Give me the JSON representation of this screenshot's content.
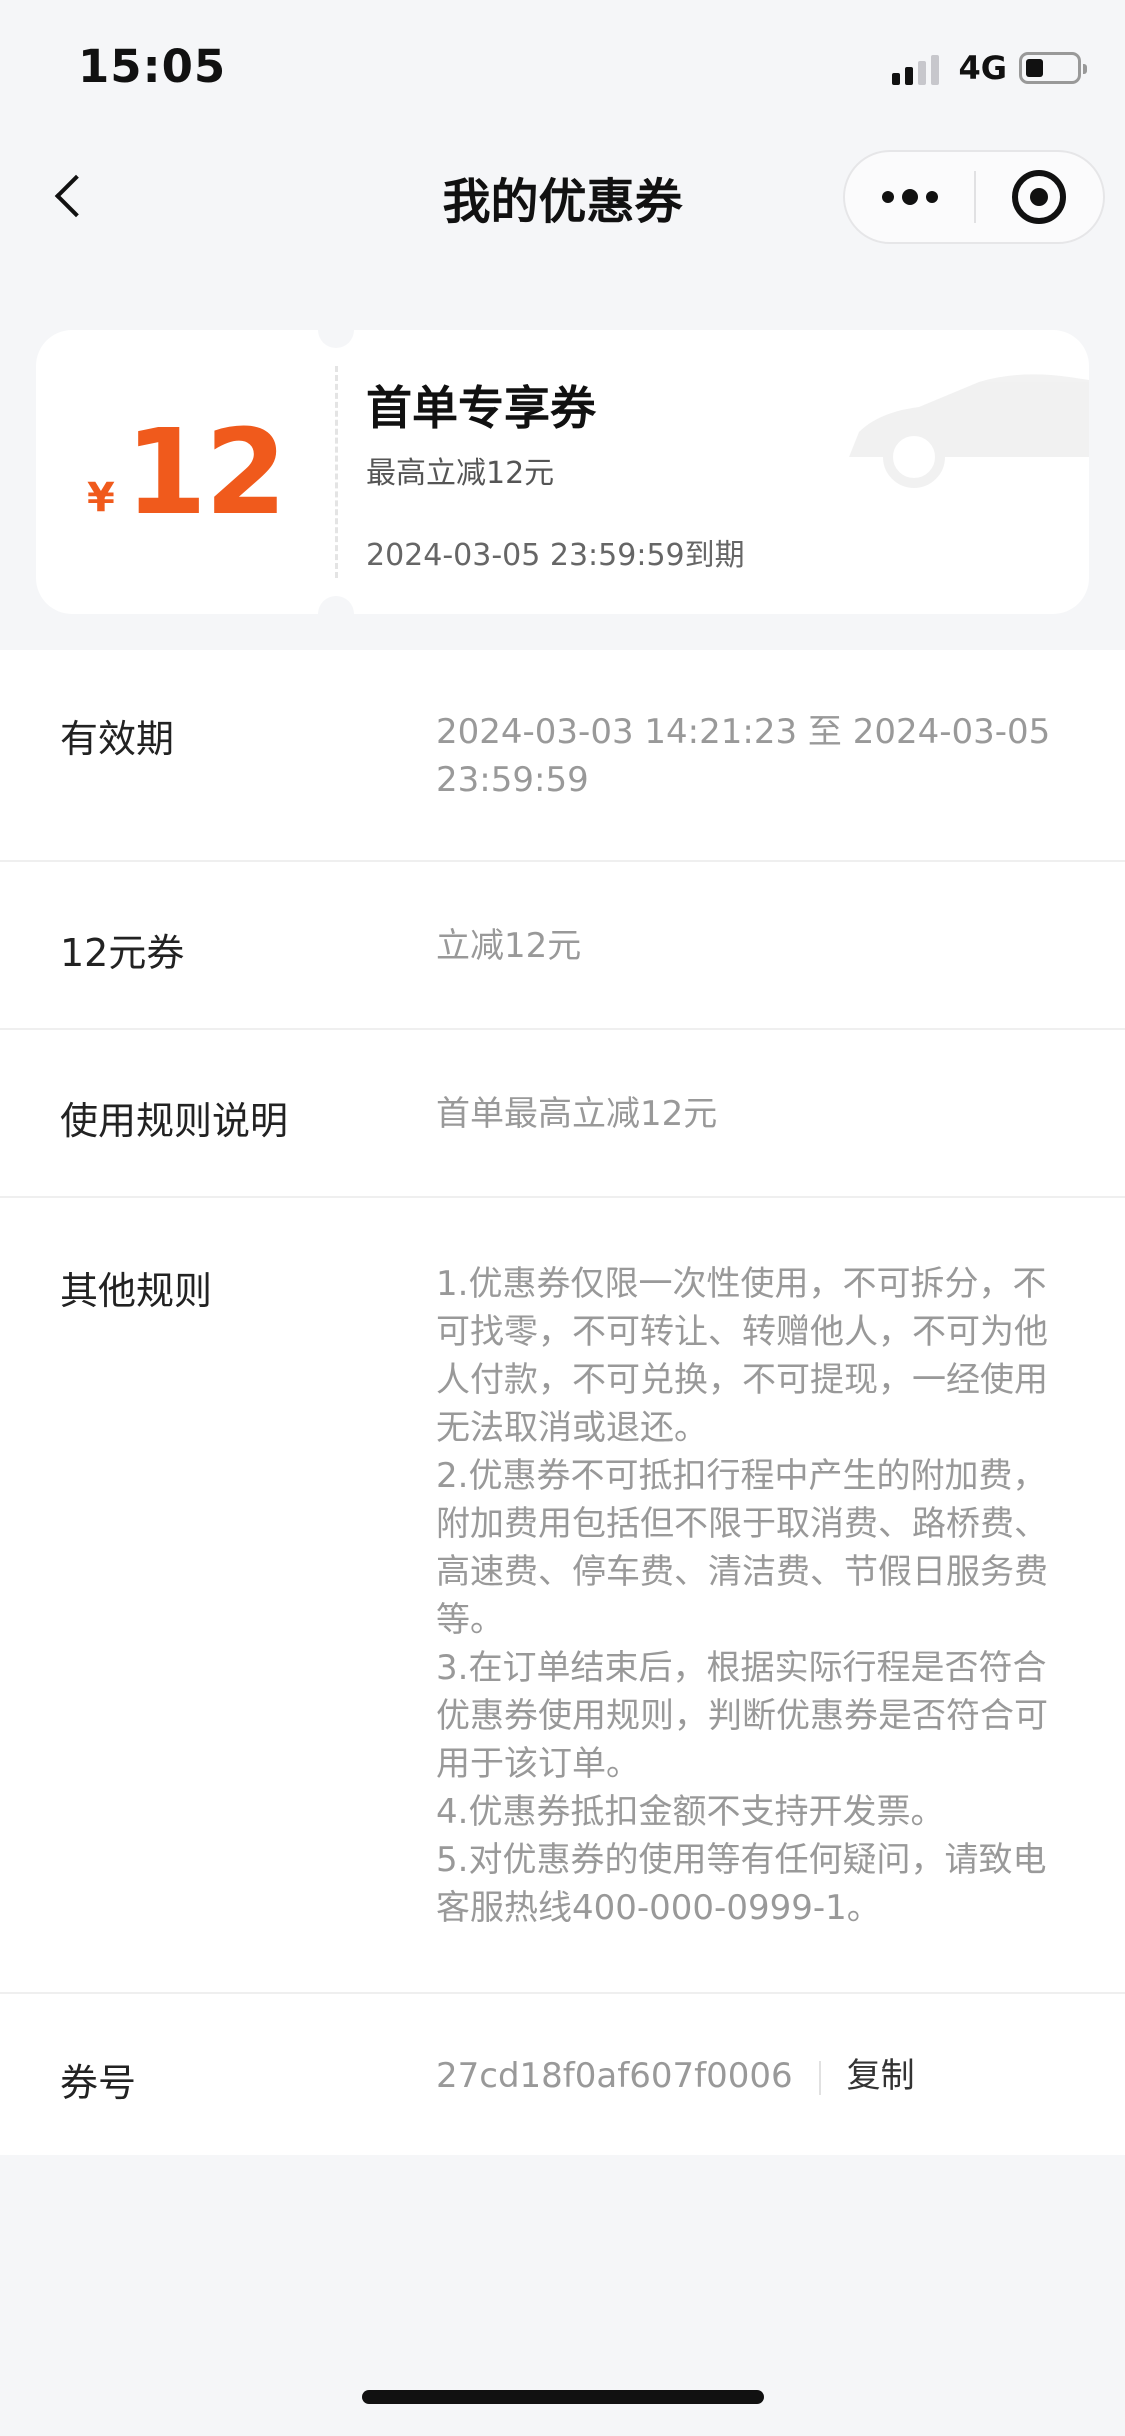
{
  "status_bar": {
    "time": "15:05",
    "network": "4G",
    "battery_level": 0.35
  },
  "nav": {
    "title": "我的优惠券"
  },
  "coupon": {
    "currency": "¥",
    "amount": "12",
    "name": "首单专享券",
    "description": "最高立减12元",
    "expires": "2024-03-05 23:59:59到期",
    "accent_color": "#f05a1c"
  },
  "details": {
    "validity": {
      "label": "有效期",
      "value": "2024-03-03 14:21:23 至 2024-03-05 23:59:59"
    },
    "coupon_type": {
      "label": "12元券",
      "value": "立减12元"
    },
    "usage_rules": {
      "label": "使用规则说明",
      "value": "首单最高立减12元"
    },
    "other_rules": {
      "label": "其他规则",
      "lines": [
        "1.优惠券仅限一次性使用，不可拆分，不可找零，不可转让、转赠他人，不可为他人付款，不可兑换，不可提现，一经使用无法取消或退还。",
        "2.优惠券不可抵扣行程中产生的附加费，附加费用包括但不限于取消费、路桥费、高速费、停车费、清洁费、节假日服务费等。",
        "3.在订单结束后，根据实际行程是否符合优惠券使用规则，判断优惠券是否符合可用于该订单。",
        "4.优惠券抵扣金额不支持开发票。",
        "5.对优惠券的使用等有任何疑问，请致电客服热线400-000-0999-1。"
      ]
    },
    "coupon_number": {
      "label": "券号",
      "value": "27cd18f0af607f0006",
      "copy_label": "复制"
    }
  }
}
